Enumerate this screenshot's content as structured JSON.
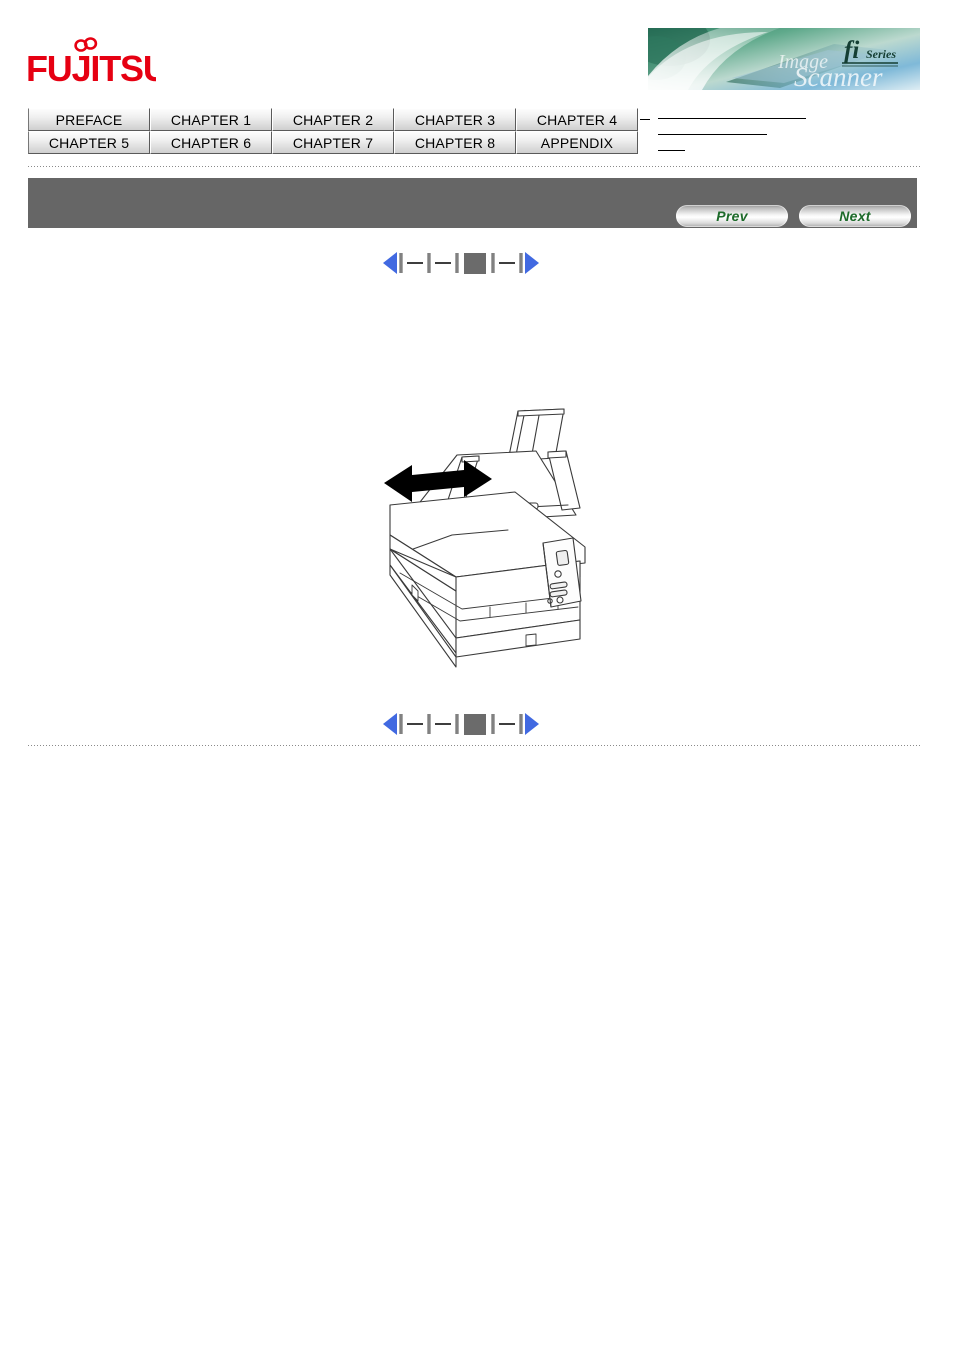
{
  "brand": {
    "logo_text": "FUJITSU",
    "logo_color": "#e60012",
    "banner_product": "fi",
    "banner_series": "Series",
    "banner_tagline": "Image Scanner"
  },
  "chapter_nav": {
    "rows": [
      [
        "PREFACE",
        "CHAPTER 1",
        "CHAPTER 2",
        "CHAPTER 3",
        "CHAPTER 4"
      ],
      [
        "CHAPTER 5",
        "CHAPTER 6",
        "CHAPTER 7",
        "CHAPTER 8",
        "APPENDIX"
      ]
    ]
  },
  "toolbar": {
    "prev_label": "Prev",
    "next_label": "Next",
    "bar_color": "#666666",
    "button_text_color": "#1d6b2a"
  },
  "page_nav": {
    "first_label": "first-page",
    "prev_step_label": "previous-page",
    "current_label": "current-page",
    "next_step_label": "next-page",
    "last_label": "last-page",
    "arrow_color": "#4169e1",
    "current_marker_color": "#6b6b6b"
  },
  "figure": {
    "name": "scanner-illustration",
    "caption": "",
    "description": "fi Series document scanner with ADF paper chute, double-headed arrow showing side guide adjustment"
  }
}
